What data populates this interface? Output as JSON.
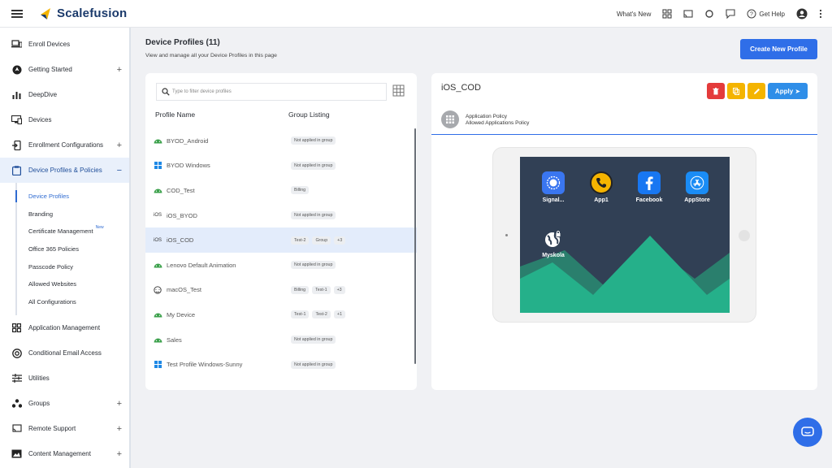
{
  "app": {
    "brand": "Scalefusion"
  },
  "topbar": {
    "whats_new": "What's New",
    "get_help": "Get Help"
  },
  "sidebar": {
    "items": [
      {
        "label": "Enroll Devices",
        "icon": "laptop-phone-icon",
        "plus": ""
      },
      {
        "label": "Getting Started",
        "icon": "rocket-icon",
        "plus": "+"
      },
      {
        "label": "DeepDive",
        "icon": "bar-chart-icon",
        "plus": ""
      },
      {
        "label": "Devices",
        "icon": "devices-icon",
        "plus": ""
      },
      {
        "label": "Enrollment Configurations",
        "icon": "enroll-config-icon",
        "plus": "+"
      },
      {
        "label": "Device Profiles & Policies",
        "icon": "clipboard-icon",
        "plus": "−"
      },
      {
        "label": "Application Management",
        "icon": "apps-grid-icon",
        "plus": ""
      },
      {
        "label": "Conditional Email Access",
        "icon": "at-sign-icon",
        "plus": ""
      },
      {
        "label": "Utilities",
        "icon": "sliders-icon",
        "plus": ""
      },
      {
        "label": "Groups",
        "icon": "groups-icon",
        "plus": "+"
      },
      {
        "label": "Remote Support",
        "icon": "cast-icon",
        "plus": "+"
      },
      {
        "label": "Content Management",
        "icon": "folder-image-icon",
        "plus": "+"
      }
    ],
    "submenu": [
      "Device Profiles",
      "Branding",
      "Certificate Management",
      "Office 365 Policies",
      "Passcode Policy",
      "Allowed Websites",
      "All Configurations"
    ],
    "new_badge": "New"
  },
  "page": {
    "title": "Device Profiles (11)",
    "subtitle": "View and manage all your Device Profiles in this page",
    "create_button": "Create New Profile"
  },
  "list": {
    "search_placeholder": "Type to filter device profiles",
    "col_name": "Profile Name",
    "col_group": "Group Listing",
    "rows": [
      {
        "name": "BYOD_Android",
        "os": "android",
        "os_label": "",
        "tags": [
          "Not applied in group"
        ]
      },
      {
        "name": "BYOD Windows",
        "os": "windows",
        "os_label": "",
        "tags": [
          "Not applied in group"
        ]
      },
      {
        "name": "COD_Test",
        "os": "android",
        "os_label": "",
        "tags": [
          "Billing"
        ]
      },
      {
        "name": "iOS_BYOD",
        "os": "ios",
        "os_label": "iOS",
        "tags": [
          "Not applied in group"
        ]
      },
      {
        "name": "iOS_COD",
        "os": "ios",
        "os_label": "iOS",
        "tags": [
          "Test-2",
          "Group",
          "+3"
        ]
      },
      {
        "name": "Lenovo Default Animation",
        "os": "android",
        "os_label": "",
        "tags": [
          "Not applied in group"
        ]
      },
      {
        "name": "macOS_Test",
        "os": "mac",
        "os_label": "",
        "tags": [
          "Billing",
          "Test-1",
          "+3"
        ]
      },
      {
        "name": "My Device",
        "os": "android",
        "os_label": "",
        "tags": [
          "Test-1",
          "Test-2",
          "+1"
        ]
      },
      {
        "name": "Sales",
        "os": "android",
        "os_label": "",
        "tags": [
          "Not applied in group"
        ]
      },
      {
        "name": "Test Profile Windows-Sunny",
        "os": "windows",
        "os_label": "",
        "tags": [
          "Not applied in group"
        ]
      }
    ]
  },
  "detail": {
    "title": "iOS_COD",
    "apply_label": "Apply ➤",
    "policy_line1": "Application Policy",
    "policy_line2": "Allowed Applications Policy",
    "apps": [
      {
        "label": "Signal...",
        "icon": "signal-app-icon",
        "color": "#3a76f0"
      },
      {
        "label": "App1",
        "icon": "phone-app-icon",
        "color": "#f5b400"
      },
      {
        "label": "Facebook",
        "icon": "facebook-app-icon",
        "color": "#1877f2"
      },
      {
        "label": "AppStore",
        "icon": "appstore-app-icon",
        "color": "#1a8cf5"
      },
      {
        "label": "Myskola",
        "icon": "myskola-web-icon",
        "color": "#314055"
      }
    ]
  },
  "colors": {
    "primary": "#2f6ee8",
    "android": "#3aa04a",
    "windows": "#1e88e5",
    "danger": "#e43b3b",
    "warning": "#f4b400"
  }
}
